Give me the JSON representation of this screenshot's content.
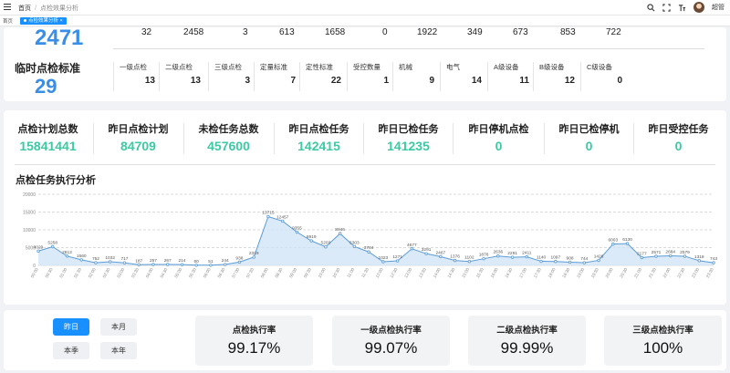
{
  "topbar": {
    "breadcrumb_home": "首页",
    "breadcrumb_sep": "/",
    "breadcrumb_current": "点检效果分析",
    "icons": [
      "search-icon",
      "fullscreen-icon",
      "font-size-icon"
    ],
    "username": "超管"
  },
  "tabs": {
    "home": "首页",
    "active": "点检效果分析"
  },
  "standards": {
    "prev_row_value": "2471",
    "prev_row_numbers": [
      "32",
      "2458",
      "3",
      "613",
      "1658",
      "0",
      "1922",
      "349",
      "673",
      "853",
      "722"
    ],
    "title": "临时点检标准",
    "total": "29",
    "items": [
      {
        "label": "一级点检",
        "value": "13"
      },
      {
        "label": "二级点检",
        "value": "13"
      },
      {
        "label": "三级点检",
        "value": "3"
      },
      {
        "label": "定量标准",
        "value": "7"
      },
      {
        "label": "定性标准",
        "value": "22"
      },
      {
        "label": "受控数量",
        "value": "1"
      },
      {
        "label": "机械",
        "value": "9"
      },
      {
        "label": "电气",
        "value": "14"
      },
      {
        "label": "A级设备",
        "value": "11"
      },
      {
        "label": "B级设备",
        "value": "12"
      },
      {
        "label": "C级设备",
        "value": "0"
      }
    ]
  },
  "kpis": [
    {
      "label": "点检计划总数",
      "value": "15841441"
    },
    {
      "label": "昨日点检计划",
      "value": "84709"
    },
    {
      "label": "未检任务总数",
      "value": "457600"
    },
    {
      "label": "昨日点检任务",
      "value": "142415"
    },
    {
      "label": "昨日已检任务",
      "value": "141235"
    },
    {
      "label": "昨日停机点检",
      "value": "0"
    },
    {
      "label": "昨日已检停机",
      "value": "0"
    },
    {
      "label": "昨日受控任务",
      "value": "0"
    }
  ],
  "chart_section": {
    "title": "点检任务执行分析"
  },
  "chart_data": {
    "type": "area",
    "x": [
      "00:00",
      "00:30",
      "01:00",
      "01:30",
      "02:00",
      "02:30",
      "03:00",
      "03:30",
      "04:00",
      "04:30",
      "05:00",
      "05:30",
      "06:00",
      "06:30",
      "07:00",
      "07:30",
      "08:00",
      "08:30",
      "09:00",
      "09:30",
      "10:00",
      "10:30",
      "11:00",
      "11:30",
      "12:00",
      "12:30",
      "13:00",
      "13:30",
      "14:00",
      "14:30",
      "15:00",
      "15:30",
      "16:00",
      "16:30",
      "17:00",
      "17:30",
      "18:00",
      "18:30",
      "19:00",
      "19:30",
      "20:00",
      "20:30",
      "21:00",
      "21:30",
      "22:00",
      "22:30",
      "23:00",
      "23:30"
    ],
    "values": [
      4029,
      5258,
      2613,
      1560,
      752,
      1032,
      717,
      187,
      257,
      267,
      214,
      60,
      51,
      244,
      938,
      2319,
      13715,
      12457,
      9355,
      6919,
      5203,
      8946,
      5303,
      3784,
      1023,
      1271,
      4677,
      3291,
      2467,
      1376,
      1102,
      1876,
      2636,
      2291,
      2411,
      1140,
      1097,
      908,
      744,
      1426,
      6003,
      6130,
      2177,
      2571,
      2684,
      2579,
      1318,
      743
    ],
    "yticks": [
      "20000",
      "15000",
      "10000",
      "5000",
      "0"
    ],
    "ylim": [
      0,
      20000
    ],
    "grid": true,
    "color": "#5b9bd5"
  },
  "period_buttons": [
    {
      "label": "昨日",
      "active": true
    },
    {
      "label": "本月",
      "active": false
    },
    {
      "label": "本季",
      "active": false
    },
    {
      "label": "本年",
      "active": false
    }
  ],
  "rates": [
    {
      "label": "点检执行率",
      "value": "99.17%"
    },
    {
      "label": "一级点检执行率",
      "value": "99.07%"
    },
    {
      "label": "二级点检执行率",
      "value": "99.99%"
    },
    {
      "label": "三级点检执行率",
      "value": "100%"
    }
  ]
}
